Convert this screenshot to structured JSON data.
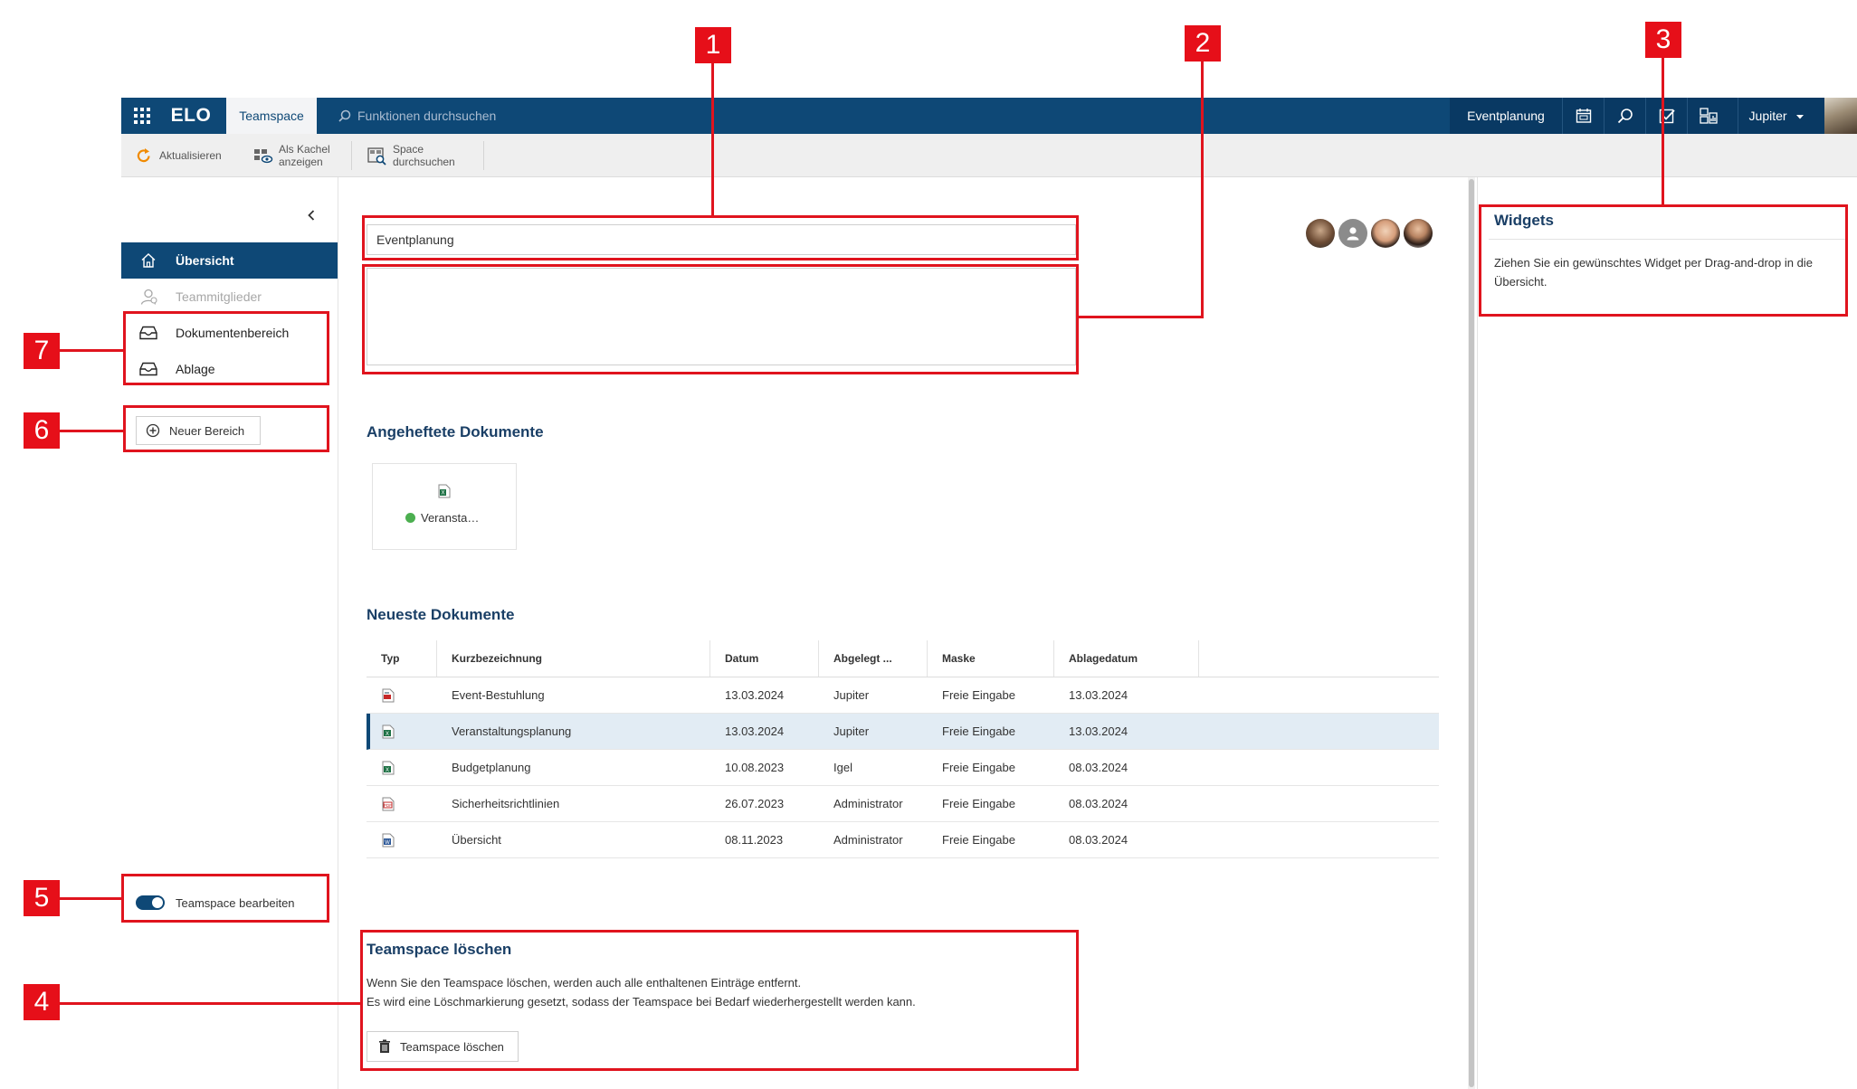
{
  "topbar": {
    "logo": "ELO",
    "active_tab": "Teamspace",
    "search_placeholder": "Funktionen durchsuchen",
    "space_name": "Eventplanung",
    "user_name": "Jupiter",
    "icons": [
      "apps-grid-icon",
      "calendar-icon",
      "search-icon",
      "tasks-check-icon",
      "dashboard-icon",
      "chevron-down-icon"
    ]
  },
  "ribbon": {
    "refresh_label": "Aktualisieren",
    "tile_view_label_1": "Als Kachel",
    "tile_view_label_2": "anzeigen",
    "space_search_label_1": "Space",
    "space_search_label_2": "durchsuchen"
  },
  "sidebar": {
    "items": [
      {
        "label": "Übersicht",
        "icon": "home-icon",
        "state": "active"
      },
      {
        "label": "Teammitglieder",
        "icon": "users-icon",
        "state": "disabled"
      },
      {
        "label": "Dokumentenbereich",
        "icon": "inbox-tray-icon",
        "state": "normal"
      },
      {
        "label": "Ablage",
        "icon": "inbox-tray-icon",
        "state": "normal"
      }
    ],
    "new_area_label": "Neuer Bereich",
    "edit_toggle_label": "Teamspace bearbeiten"
  },
  "main": {
    "title_value": "Eventplanung",
    "description_value": "",
    "pinned_title": "Angeheftete Dokumente",
    "pinned_doc_label": "Veransta…",
    "recent_title": "Neueste Dokumente",
    "table": {
      "headers": [
        "Typ",
        "Kurzbezeichnung",
        "Datum",
        "Abgelegt ...",
        "Maske",
        "Ablagedatum"
      ],
      "rows": [
        {
          "type": "png-file-icon",
          "name": "Event-Bestuhlung",
          "date": "13.03.2024",
          "filed_by": "Jupiter",
          "mask": "Freie Eingabe",
          "filed_date": "13.03.2024"
        },
        {
          "type": "excel-file-icon",
          "name": "Veranstaltungsplanung",
          "date": "13.03.2024",
          "filed_by": "Jupiter",
          "mask": "Freie Eingabe",
          "filed_date": "13.03.2024"
        },
        {
          "type": "excel-file-icon",
          "name": "Budgetplanung",
          "date": "10.08.2023",
          "filed_by": "Igel",
          "mask": "Freie Eingabe",
          "filed_date": "08.03.2024"
        },
        {
          "type": "pdf-file-icon",
          "name": "Sicherheitsrichtlinien",
          "date": "26.07.2023",
          "filed_by": "Administrator",
          "mask": "Freie Eingabe",
          "filed_date": "08.03.2024"
        },
        {
          "type": "word-file-icon",
          "name": "Übersicht",
          "date": "08.11.2023",
          "filed_by": "Administrator",
          "mask": "Freie Eingabe",
          "filed_date": "08.03.2024"
        }
      ],
      "selected_row": 1
    },
    "delete": {
      "title": "Teamspace löschen",
      "line1": "Wenn Sie den Teamspace löschen, werden auch alle enthaltenen Einträge entfernt.",
      "line2": "Es wird eine Löschmarkierung gesetzt, sodass der Teamspace bei Bedarf wiederhergestellt werden kann.",
      "button_label": "Teamspace löschen"
    }
  },
  "widgets": {
    "title": "Widgets",
    "text": "Ziehen Sie ein gewünschtes Widget per Drag-and-drop in die Übersicht."
  },
  "annotations": [
    "1",
    "2",
    "3",
    "4",
    "5",
    "6",
    "7"
  ],
  "colors": {
    "brand": "#0e4876",
    "brand_dark": "#093963",
    "annotation": "#e0141e",
    "selected_row": "#e2ecf4"
  }
}
